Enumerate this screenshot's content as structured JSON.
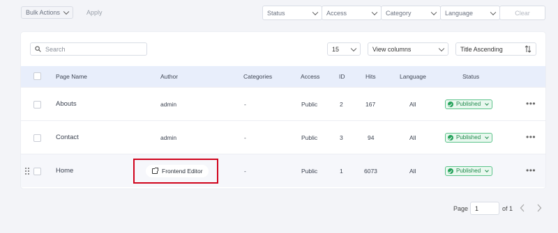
{
  "toolbar": {
    "bulk_actions": "Bulk Actions",
    "apply": "Apply",
    "filters": {
      "status": "Status",
      "access": "Access",
      "category": "Category",
      "language": "Language",
      "clear": "Clear"
    }
  },
  "controls": {
    "search_placeholder": "Search",
    "per_page": "15",
    "view_columns": "View columns",
    "sort": "Title Ascending"
  },
  "table": {
    "headers": [
      "Page Name",
      "Author",
      "Categories",
      "Access",
      "ID",
      "Hits",
      "Language",
      "Status"
    ],
    "rows": [
      {
        "name": "Abouts",
        "author": "admin",
        "categories": "-",
        "access": "Public",
        "id": "2",
        "hits": "167",
        "language": "All",
        "status": "Published"
      },
      {
        "name": "Contact",
        "author": "admin",
        "categories": "-",
        "access": "Public",
        "id": "3",
        "hits": "94",
        "language": "All",
        "status": "Published"
      },
      {
        "name": "Home",
        "author": "",
        "categories": "-",
        "access": "Public",
        "id": "1",
        "hits": "6073",
        "language": "All",
        "status": "Published"
      }
    ],
    "more": "•••",
    "frontend_editor": "Frontend Editor"
  },
  "pagination": {
    "page_label": "Page",
    "page_value": "1",
    "of_label": "of 1"
  },
  "colors": {
    "header_bg": "#e8eefb",
    "published_green": "#25a35b",
    "highlight_red": "#d0021b"
  }
}
